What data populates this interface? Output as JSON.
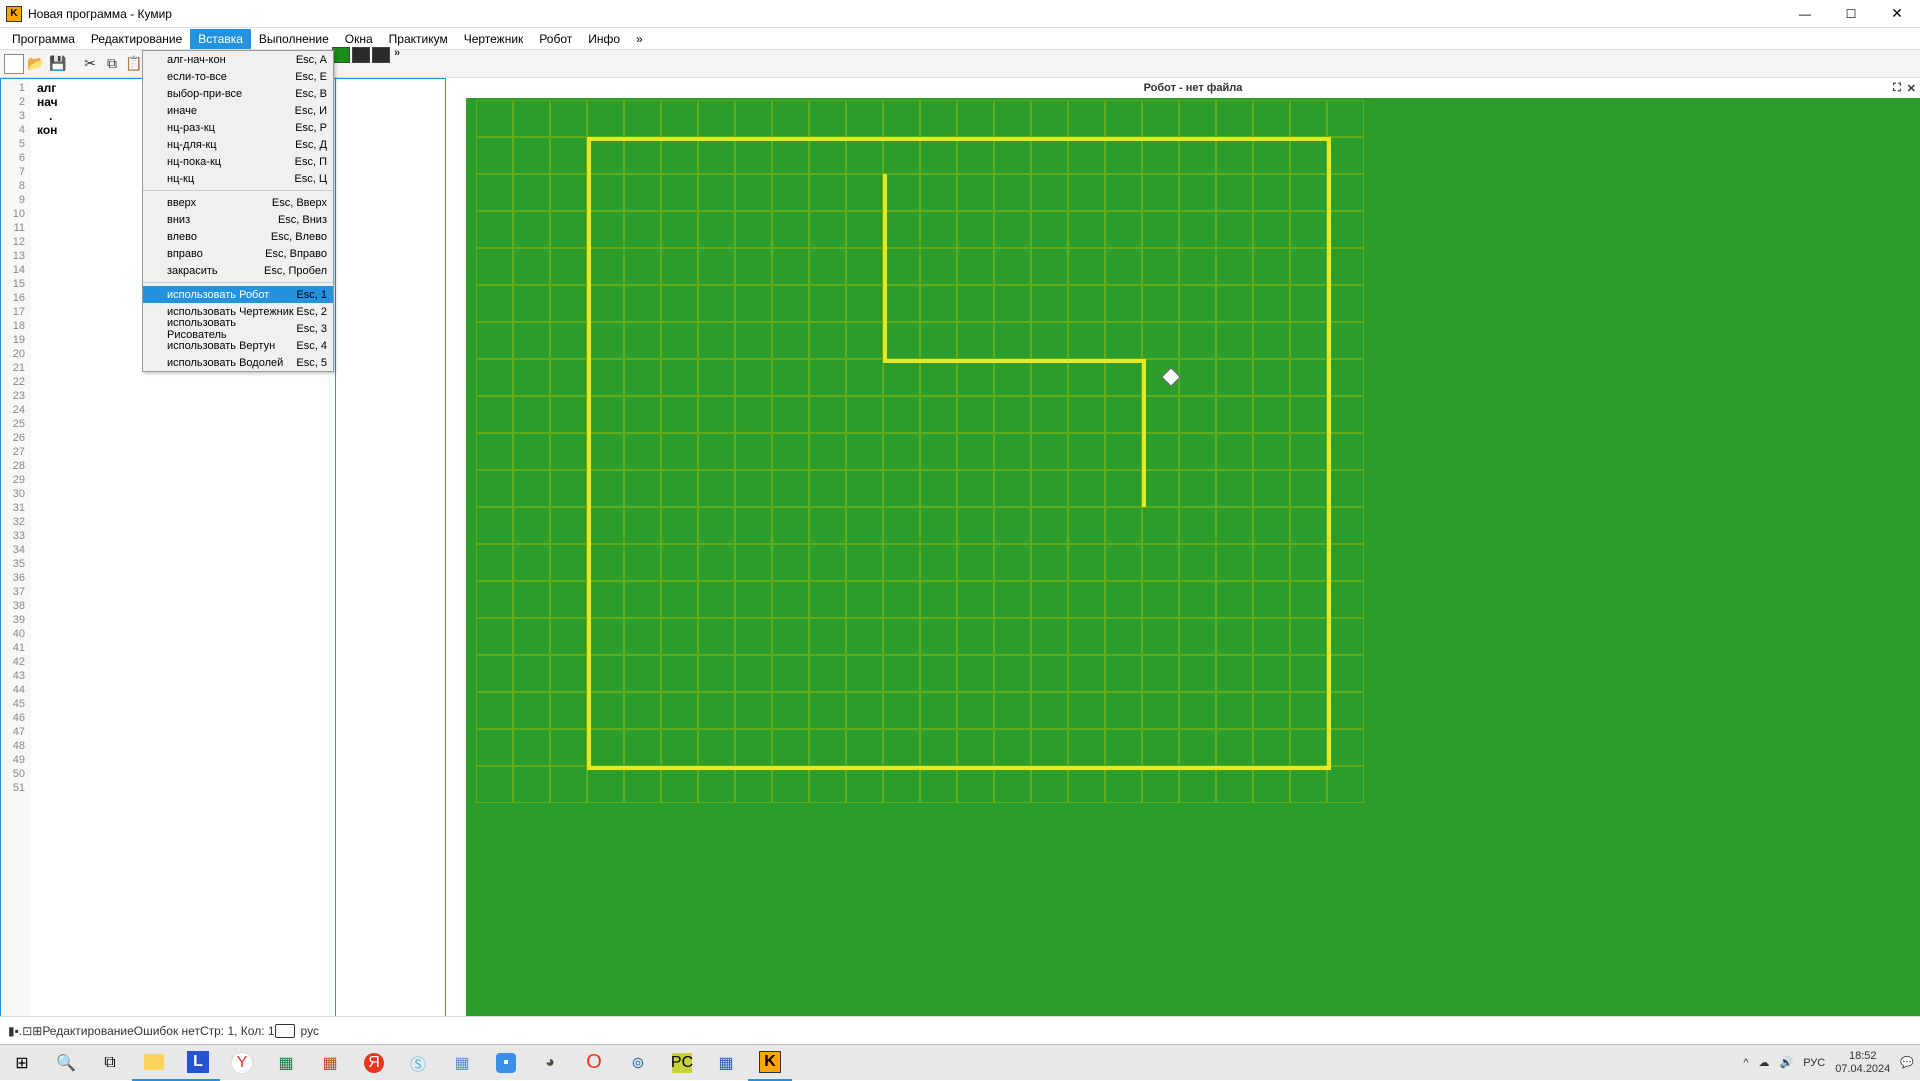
{
  "title": "Новая программа - Кумир",
  "menubar": [
    "Программа",
    "Редактирование",
    "Вставка",
    "Выполнение",
    "Окна",
    "Практикум",
    "Чертежник",
    "Робот",
    "Инфо",
    "»"
  ],
  "active_menu_index": 2,
  "dropdown": {
    "groups": [
      [
        {
          "label": "алг-нач-кон",
          "shortcut": "Esc, A"
        },
        {
          "label": "если-то-все",
          "shortcut": "Esc, Е"
        },
        {
          "label": "выбор-при-все",
          "shortcut": "Esc, В"
        },
        {
          "label": "иначе",
          "shortcut": "Esc, И"
        },
        {
          "label": "нц-раз-кц",
          "shortcut": "Esc, Р"
        },
        {
          "label": "нц-для-кц",
          "shortcut": "Esc, Д"
        },
        {
          "label": "нц-пока-кц",
          "shortcut": "Esc, П"
        },
        {
          "label": "нц-кц",
          "shortcut": "Esc, Ц"
        }
      ],
      [
        {
          "label": "вверх",
          "shortcut": "Esc, Вверх"
        },
        {
          "label": "вниз",
          "shortcut": "Esc, Вниз"
        },
        {
          "label": "влево",
          "shortcut": "Esc, Влево"
        },
        {
          "label": "вправо",
          "shortcut": "Esc, Вправо"
        },
        {
          "label": "закрасить",
          "shortcut": "Esc, Пробел"
        }
      ],
      [
        {
          "label": "использовать Робот",
          "shortcut": "Esc, 1",
          "hl": true
        },
        {
          "label": "использовать Чертежник",
          "shortcut": "Esc, 2"
        },
        {
          "label": "использовать Рисователь",
          "shortcut": "Esc, 3"
        },
        {
          "label": "использовать Вертун",
          "shortcut": "Esc, 4"
        },
        {
          "label": "использовать Водолей",
          "shortcut": "Esc, 5"
        }
      ]
    ]
  },
  "code_lines": [
    "алг",
    "нач",
    ".",
    "кон"
  ],
  "gutter_max": 51,
  "robot_header": "Робот - нет файла",
  "status": {
    "edit": "Редактирование",
    "errors": "Ошибок нет",
    "pos": "Стр: 1, Кол: 1",
    "lang": "рус"
  },
  "tray": {
    "lang": "РУС",
    "time": "18:52",
    "date": "07.04.2024"
  },
  "field": {
    "cell": 37,
    "cols": 24,
    "rows": 19,
    "boundary": {
      "c0": 3,
      "r0": 1,
      "c1": 23,
      "r1": 18
    },
    "inner_walls": [
      {
        "c": 11,
        "r0": 2,
        "r1": 7,
        "dir": "v"
      },
      {
        "c0": 11,
        "c1": 18,
        "r": 7,
        "dir": "h"
      },
      {
        "c": 18,
        "r0": 7,
        "r1": 11,
        "dir": "v"
      }
    ],
    "robot": {
      "c": 18,
      "r": 7
    }
  }
}
